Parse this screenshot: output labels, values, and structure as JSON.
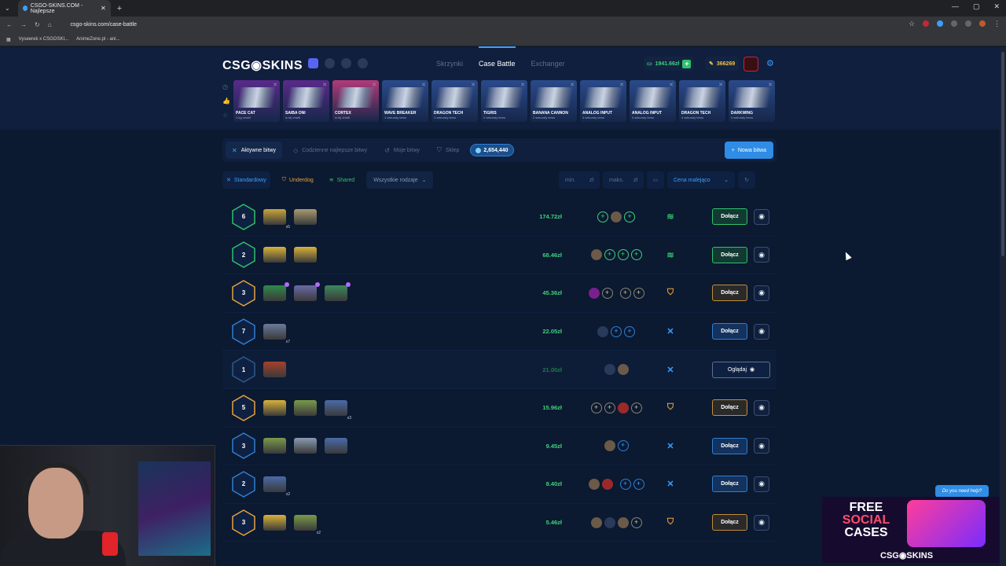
{
  "browser": {
    "tab_title": "CSGO-SKINS.COM - Najlepsze",
    "url": "csgo-skins.com/case-battle",
    "bookmarks": [
      "Vyseerek x CSGOSKI...",
      "AnimeZone.pl - ani..."
    ]
  },
  "header": {
    "logo": "CSG◉SKINS",
    "nav": [
      "Skrzynki",
      "Case Battle",
      "Exchanger"
    ],
    "balance": "1941.66zł",
    "coins": "366269"
  },
  "drops": [
    {
      "name": "PACE CAT",
      "sub": "1 kg chuilli",
      "color": "#5a2a8a"
    },
    {
      "name": "SAIBA ONI",
      "sub": "w tej chwili",
      "color": "#5a2a8a"
    },
    {
      "name": "CORTEX",
      "sub": "w tej chwili",
      "color": "#b23a7a"
    },
    {
      "name": "WAVE BREAKER",
      "sub": "1 sekundy temu",
      "color": "#2a4a8a"
    },
    {
      "name": "DRAGON TECH",
      "sub": "1 sekundy temu",
      "color": "#2a4a8a"
    },
    {
      "name": "TIGRIS",
      "sub": "2 sekundy temu",
      "color": "#2a4a8a"
    },
    {
      "name": "BANANA CANNON",
      "sub": "2 sekundy temu",
      "color": "#2a4a8a"
    },
    {
      "name": "ANALOG INPUT",
      "sub": "4 sekundy temu",
      "color": "#2a4a8a"
    },
    {
      "name": "ANALOG INPUT",
      "sub": "4 sekundy temu",
      "color": "#2a4a8a"
    },
    {
      "name": "DRAGON TECH",
      "sub": "4 sekundy temu",
      "color": "#2a4a8a"
    },
    {
      "name": "DARKWING",
      "sub": "4 sekundy temu",
      "color": "#2a4a8a"
    }
  ],
  "subtabs": {
    "active": "Aktywne bitwy",
    "daily": "Codzienne najlepsze bitwy",
    "mine": "Moje bitwy",
    "shop": "Sklep",
    "shop_value": "2,654,440",
    "new_battle": "Nowa bitwa"
  },
  "filters": {
    "standard": "Standardowy",
    "underdog": "Underdog",
    "shared": "Shared",
    "types": "Wszystkie rodzaje",
    "min": "min.",
    "max": "maks.",
    "currency": "zł",
    "sort": "Cena malejąco"
  },
  "rows": [
    {
      "rounds": "6",
      "ring": "#2ec26b",
      "price": "174.72zł",
      "mode": "sh",
      "join": "Dołącz",
      "cases": [
        {
          "c": "#c8a53a",
          "n": "x5"
        },
        {
          "c": "#a89a70"
        }
      ],
      "players": [
        {
          "t": "plus"
        },
        {
          "t": "av"
        },
        {
          "t": "plus"
        }
      ]
    },
    {
      "rounds": "2",
      "ring": "#2ec26b",
      "price": "68.46zł",
      "mode": "sh",
      "join": "Dołącz",
      "cases": [
        {
          "c": "#d9b23a"
        },
        {
          "c": "#d9b23a"
        }
      ],
      "players": [
        {
          "t": "av"
        },
        {
          "t": "plus"
        },
        {
          "t": "plus"
        },
        {
          "t": "plus"
        }
      ]
    },
    {
      "rounds": "3",
      "ring": "#e8a23c",
      "price": "45.36zł",
      "mode": "und",
      "join": "Dołącz",
      "cases": [
        {
          "c": "#2f8a4a",
          "b": true
        },
        {
          "c": "#6a6aa8",
          "b": true
        },
        {
          "c": "#3a8a5a",
          "b": true
        }
      ],
      "players": [
        {
          "t": "avp"
        },
        {
          "t": "gold"
        },
        {
          "t": "gap"
        },
        {
          "t": "gold"
        },
        {
          "t": "gold"
        }
      ]
    },
    {
      "rounds": "7",
      "ring": "#2f7fd0",
      "price": "22.05zł",
      "mode": "std",
      "join": "Dołącz",
      "cases": [
        {
          "c": "#6a7a9a",
          "n": "x7"
        }
      ],
      "players": [
        {
          "t": "avb"
        },
        {
          "t": "blue"
        },
        {
          "t": "blue"
        }
      ]
    },
    {
      "rounds": "1",
      "ring": "#2f5a8a",
      "price": "21.00zł",
      "mode": "std",
      "join": "Oglądaj",
      "watch": true,
      "cases": [
        {
          "c": "#a8402a"
        }
      ],
      "players": [
        {
          "t": "avb"
        },
        {
          "t": "av"
        }
      ]
    },
    {
      "rounds": "5",
      "ring": "#e8a23c",
      "price": "15.96zł",
      "mode": "und",
      "join": "Dołącz",
      "cases": [
        {
          "c": "#d9b23a"
        },
        {
          "c": "#7a9a4a"
        },
        {
          "c": "#4a6aa8",
          "n": "x3"
        }
      ],
      "players": [
        {
          "t": "gold"
        },
        {
          "t": "gold"
        },
        {
          "t": "avr"
        },
        {
          "t": "gold"
        }
      ]
    },
    {
      "rounds": "3",
      "ring": "#2f7fd0",
      "price": "9.45zł",
      "mode": "std",
      "join": "Dołącz",
      "cases": [
        {
          "c": "#7a9a4a"
        },
        {
          "c": "#8a9ab0"
        },
        {
          "c": "#4a6aa8"
        }
      ],
      "players": [
        {
          "t": "av"
        },
        {
          "t": "blue"
        }
      ]
    },
    {
      "rounds": "2",
      "ring": "#2f7fd0",
      "price": "8.40zł",
      "mode": "std",
      "join": "Dołącz",
      "cases": [
        {
          "c": "#4a6aa8",
          "n": "x2"
        }
      ],
      "players": [
        {
          "t": "av"
        },
        {
          "t": "avr"
        },
        {
          "t": "gap"
        },
        {
          "t": "blue"
        },
        {
          "t": "blue"
        }
      ]
    },
    {
      "rounds": "3",
      "ring": "#e8a23c",
      "price": "5.46zł",
      "mode": "und",
      "join": "Dołącz",
      "cases": [
        {
          "c": "#d9b23a"
        },
        {
          "c": "#7a9a4a",
          "n": "x2"
        }
      ],
      "players": [
        {
          "t": "av"
        },
        {
          "t": "avb"
        },
        {
          "t": "av"
        },
        {
          "t": "gold"
        }
      ]
    }
  ],
  "ad": {
    "line1": "FREE",
    "line2": "SOCIAL",
    "line3": "CASES",
    "logo": "CSG◉SKINS",
    "help": "Do you need help?"
  }
}
